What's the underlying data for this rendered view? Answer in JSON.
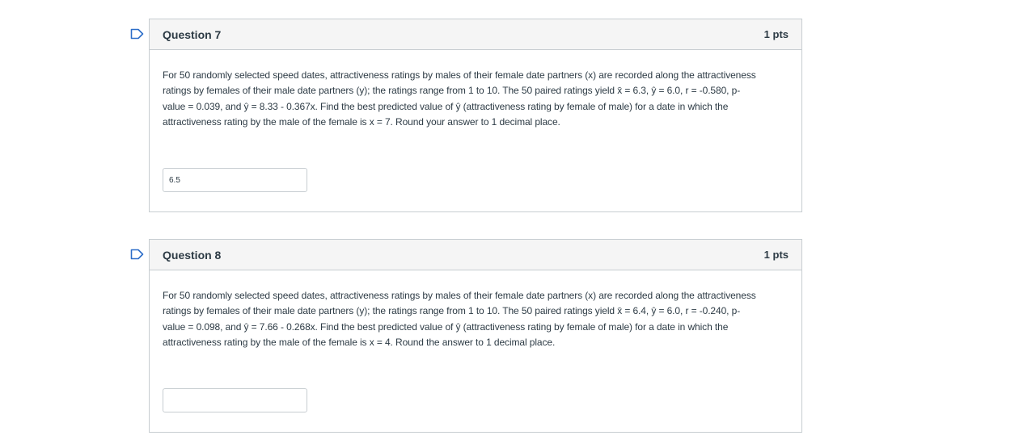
{
  "questions": [
    {
      "title": "Question 7",
      "points": "1 pts",
      "lines": [
        "For 50 randomly selected speed dates, attractiveness ratings by males of their female date partners (x) are recorded along the attractiveness",
        "ratings by females of their male date partners (y); the ratings range from 1 to 10. The 50 paired ratings yield  x̄ = 6.3,  ŷ = 6.0,  r = -0.580,  p-",
        "value = 0.039, and  ŷ = 8.33 - 0.367x. Find the best predicted value of ŷ (attractiveness rating by female of male) for a date in which the",
        "attractiveness rating by the male of the female is x = 7. Round your answer to 1 decimal place."
      ],
      "answer_value": "6.5",
      "flag_icon": "flag-bookmark-icon"
    },
    {
      "title": "Question 8",
      "points": "1 pts",
      "lines": [
        "For 50 randomly selected speed dates, attractiveness ratings by males of their female date partners (x) are recorded along the attractiveness",
        "ratings by females of their male date partners (y); the ratings range from 1 to 10. The 50 paired ratings yield  x̄ = 6.4,  ŷ = 6.0,  r = -0.240,  p-",
        "value = 0.098, and  ŷ = 7.66 - 0.268x. Find the best predicted value of ŷ (attractiveness rating by female of male) for a date in which the",
        "attractiveness rating by the male of the female is x = 4. Round the answer to 1 decimal place."
      ],
      "answer_value": "",
      "flag_icon": "flag-bookmark-icon"
    }
  ]
}
